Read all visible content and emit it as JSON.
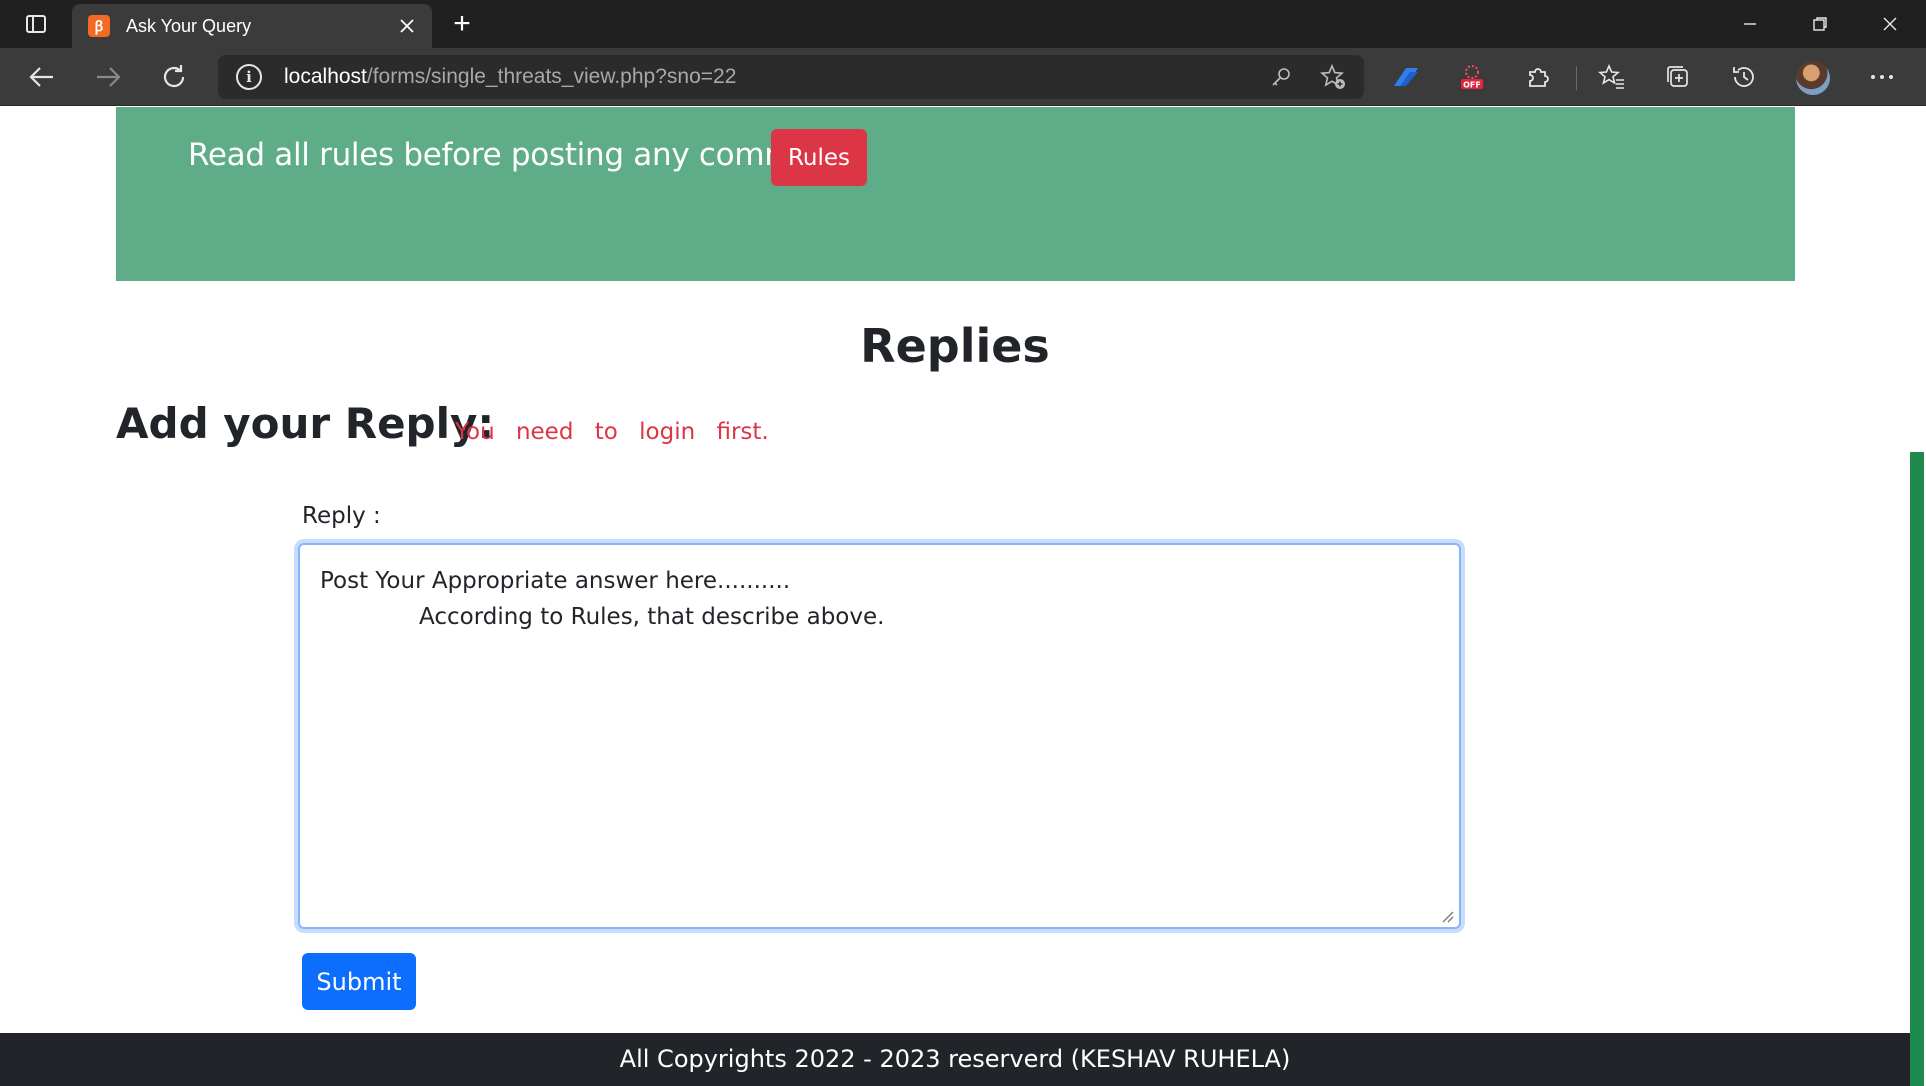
{
  "browser": {
    "tab": {
      "title": "Ask Your Query",
      "favicon": "xampp-icon",
      "favicon_letter": "ꞵ"
    },
    "new_tab_symbol": "+",
    "address_bar": {
      "host": "localhost",
      "path": "/forms/single_threats_view.php?sno=22"
    }
  },
  "banner": {
    "message": "Read all rules before posting any comment.",
    "rules_button": "Rules",
    "color": "#5fac88"
  },
  "replies": {
    "heading": "Replies",
    "add_heading": "Add your Reply:",
    "login_notice": "You need to login first.",
    "label": "Reply :",
    "placeholder_line1": "Post Your Appropriate answer here..........",
    "placeholder_line2": "According to Rules, that describe above.",
    "submit": "Submit"
  },
  "footer": {
    "text": "All Copyrights 2022 - 2023 reserverd (KESHAV RUHELA)"
  },
  "colors": {
    "danger": "#dc3545",
    "primary": "#0d6efd",
    "footer_bg": "#212529"
  }
}
